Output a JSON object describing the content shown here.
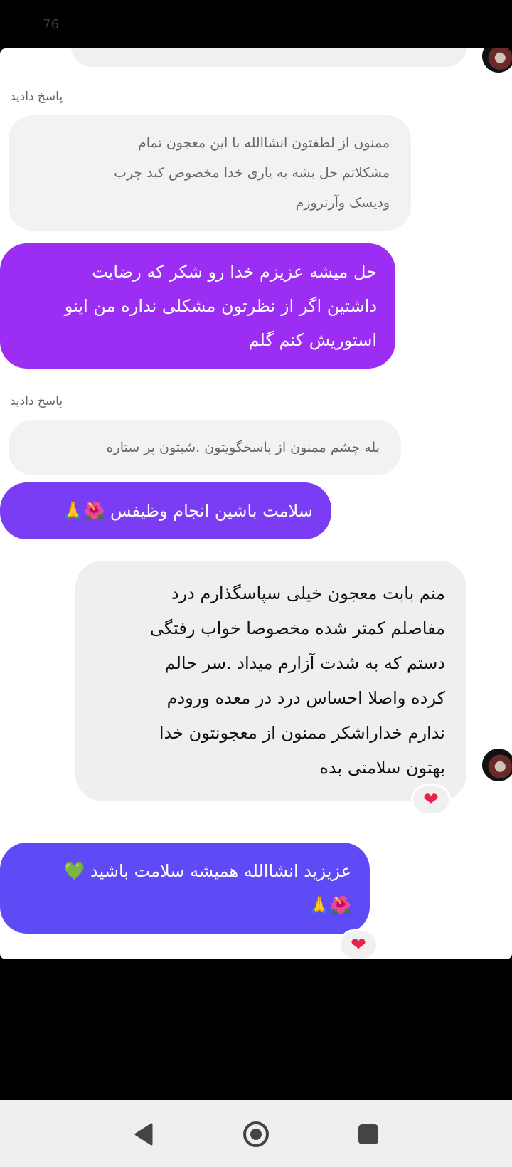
{
  "status": {
    "time": "76"
  },
  "messages": {
    "reply_label_1": "پاسخ دادید",
    "quote_1": "ممنون از لطفتون انشاالله با این معجون تمام\nمشکلاتم حل بشه به یاری خدا مخصوص کبد چرب\nودیسک وآرتروزم",
    "mine_1": "حل میشه عزیزم خدا رو شکر که رضایت\nداشتین اگر از نظرتون مشکلی نداره من اینو\nاستوریش کنم گلم",
    "reply_label_2": "پاسخ دادید",
    "quote_2": "بله چشم ممنون از پاسخگویتون .شبتون پر ستاره",
    "mine_2": "سلامت باشین انجام وظیفس 🌺🙏",
    "theirs_1": "منم بابت معجون خیلی سپاسگذارم درد\nمفاصلم کمتر شده مخصوصا خواب رفتگی\nدستم که به شدت آزارم میداد .سر حالم\nکرده واصلا احساس درد در معده ورودم\nندارم خداراشکر ممنون از معجونتون خدا\nبهتون سلامتی بده",
    "mine_3": "عزیزید انشاالله همیشه سلامت باشید 💚\n🌺🙏",
    "reaction_heart": "❤"
  },
  "colors": {
    "mine_purple": "#9b2ef2",
    "mine_violet": "#7a3df4",
    "mine_indigo": "#5f4bf6"
  }
}
